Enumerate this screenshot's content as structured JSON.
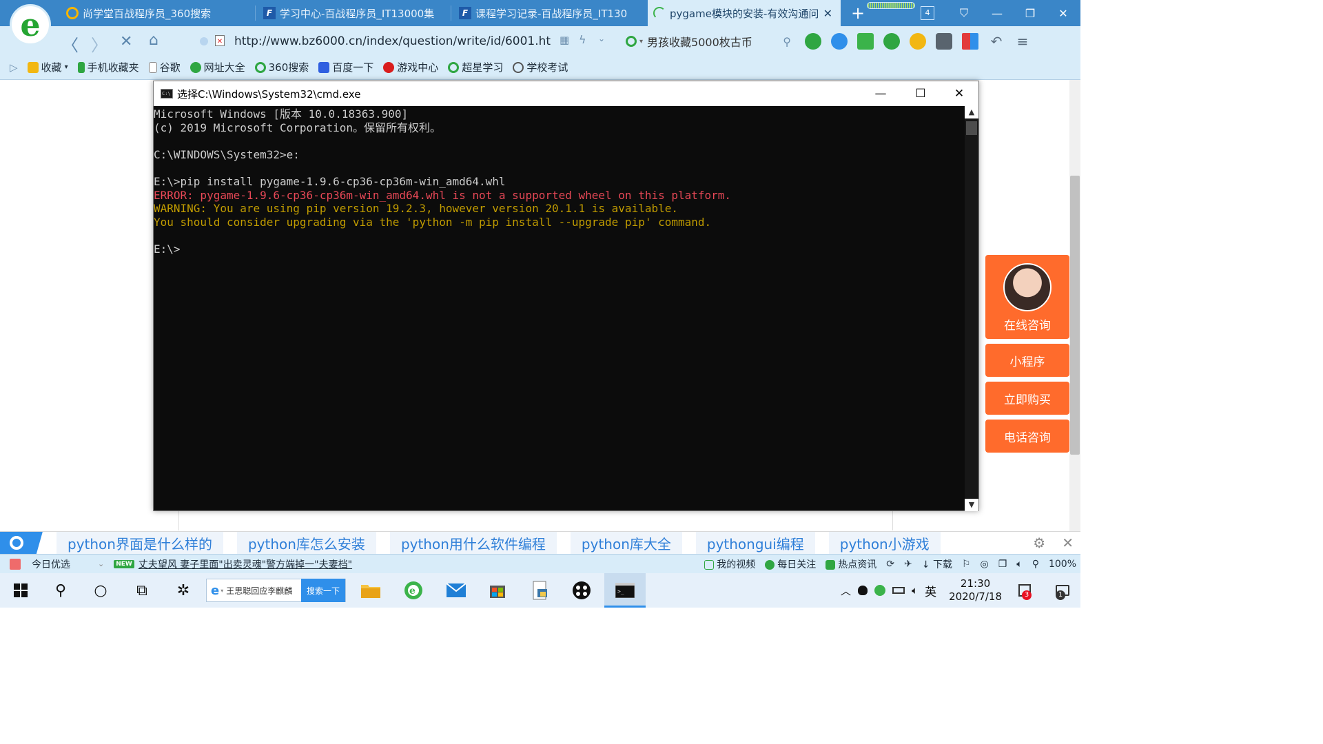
{
  "browser": {
    "tabs": [
      {
        "label": "尚学堂百战程序员_360搜索"
      },
      {
        "label": "学习中心-百战程序员_IT13000集"
      },
      {
        "label": "课程学习记录-百战程序员_IT130"
      },
      {
        "label": "pygame模块的安装-有效沟通问"
      }
    ],
    "tab_count": "4",
    "url": "http://www.bz6000.cn/index/question/write/id/6001.ht",
    "search_text": "男孩收藏5000枚古币",
    "favorites": [
      "收藏",
      "手机收藏夹",
      "谷歌",
      "网址大全",
      "360搜索",
      "百度一下",
      "游戏中心",
      "超星学习",
      "学校考试"
    ]
  },
  "cmd": {
    "title": "选择C:\\Windows\\System32\\cmd.exe",
    "lines": [
      {
        "text": "Microsoft Windows [版本 10.0.18363.900]",
        "kind": "normal"
      },
      {
        "text": "(c) 2019 Microsoft Corporation。保留所有权利。",
        "kind": "normal"
      },
      {
        "text": "",
        "kind": "normal"
      },
      {
        "text": "C:\\WINDOWS\\System32>e:",
        "kind": "normal"
      },
      {
        "text": "",
        "kind": "normal"
      },
      {
        "text": "E:\\>pip install pygame-1.9.6-cp36-cp36m-win_amd64.whl",
        "kind": "normal"
      },
      {
        "text": "ERROR: pygame-1.9.6-cp36-cp36m-win_amd64.whl is not a supported wheel on this platform.",
        "kind": "err"
      },
      {
        "text": "WARNING: You are using pip version 19.2.3, however version 20.1.1 is available.",
        "kind": "warn"
      },
      {
        "text": "You should consider upgrading via the 'python -m pip install --upgrade pip' command.",
        "kind": "warn"
      },
      {
        "text": "",
        "kind": "normal"
      },
      {
        "text": "E:\\>",
        "kind": "normal"
      }
    ]
  },
  "consult": {
    "main_label": "在线咨询",
    "buttons": [
      "小程序",
      "立即购买",
      "电话咨询"
    ]
  },
  "related_searches": [
    "python界面是什么样的",
    "python库怎么安装",
    "python用什么软件编程",
    "python库大全",
    "pythongui编程",
    "python小游戏"
  ],
  "statusbar": {
    "today": "今日优选",
    "new_badge": "NEW",
    "headline": "丈夫望风 妻子里面\"出卖灵魂\"警方端掉一\"夫妻档\"",
    "items": [
      "我的视频",
      "每日关注",
      "热点资讯"
    ],
    "download": "下载",
    "zoom": "100%"
  },
  "taskbar": {
    "search_text": "王思聪回应李麒麟",
    "search_button": "搜索一下",
    "ime": "英",
    "time": "21:30",
    "date": "2020/7/18",
    "notification_count": "3",
    "chat_count": "1"
  },
  "colors": {
    "browser_blue": "#3a86c8",
    "chrome_light": "#d8ecf9",
    "cmd_bg": "#0c0c0c",
    "cmd_text": "#cccccc",
    "cmd_error": "#e74856",
    "cmd_warning": "#c19c00",
    "consult_orange": "#ff6b2c"
  }
}
